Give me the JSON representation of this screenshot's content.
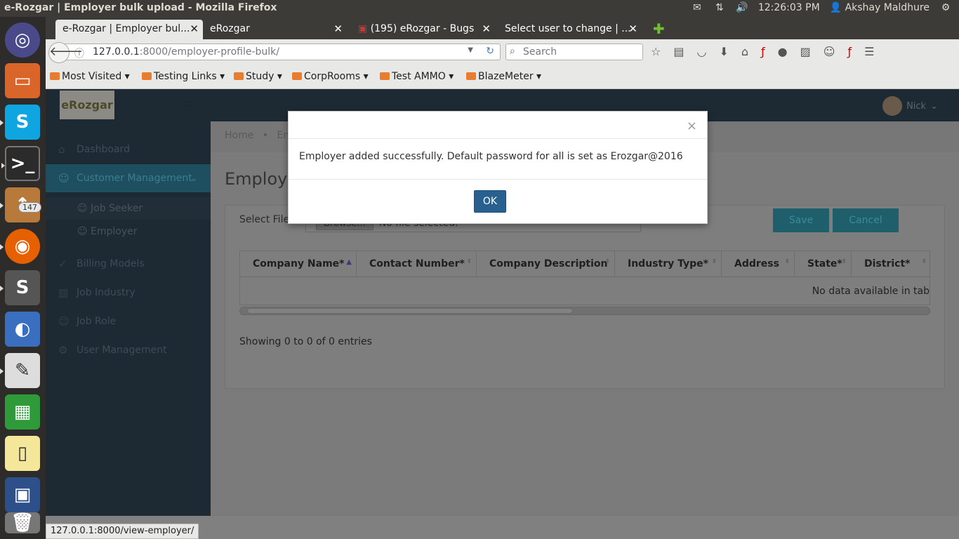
{
  "window": {
    "title": "e-Rozgar | Employer bulk upload - Mozilla Firefox"
  },
  "tray": {
    "time": "12:26:03 PM",
    "user": "Akshay Maldhure"
  },
  "launcher": {
    "badge": "147"
  },
  "tabs": [
    {
      "label": "e-Rozgar | Employer bul..."
    },
    {
      "label": "eRozgar"
    },
    {
      "label": "(195) eRozgar - Bugs"
    },
    {
      "label": "Select user to change | ..."
    }
  ],
  "nav": {
    "url_host": "127.0.0.1",
    "url_rest": ":8000/employer-profile-bulk/",
    "search_placeholder": "Search"
  },
  "bookmarks": [
    "Most Visited",
    "Testing Links",
    "Study",
    "CorpRooms",
    "Test AMMO",
    "BlazeMeter"
  ],
  "app": {
    "logo": "eRozgar",
    "user_name": "Nick",
    "sidebar": [
      {
        "label": "Dashboard"
      },
      {
        "label": "Customer Management"
      },
      {
        "label": "Job Seeker"
      },
      {
        "label": "Employer"
      },
      {
        "label": "Billing Models"
      },
      {
        "label": "Job Industry"
      },
      {
        "label": "Job Role"
      },
      {
        "label": "User Management"
      }
    ],
    "breadcrumb": {
      "home": "Home",
      "current": "Emp"
    },
    "page_title": "Employer",
    "select_file_label": "Select File",
    "browse_label": "Browse...",
    "file_status": "No file selected.",
    "save_label": "Save",
    "cancel_label": "Cancel",
    "table": {
      "columns": [
        "Company Name*",
        "Contact Number*",
        "Company Description",
        "Industry Type*",
        "Address",
        "State*",
        "District*"
      ],
      "empty_text": "No data available in tab"
    },
    "showing": "Showing 0 to 0 of 0 entries"
  },
  "modal": {
    "message": "Employer added successfully. Default password for all is set as Erozgar@2016",
    "ok_label": "OK"
  },
  "statusbar": {
    "url": "127.0.0.1:8000/view-employer/"
  }
}
